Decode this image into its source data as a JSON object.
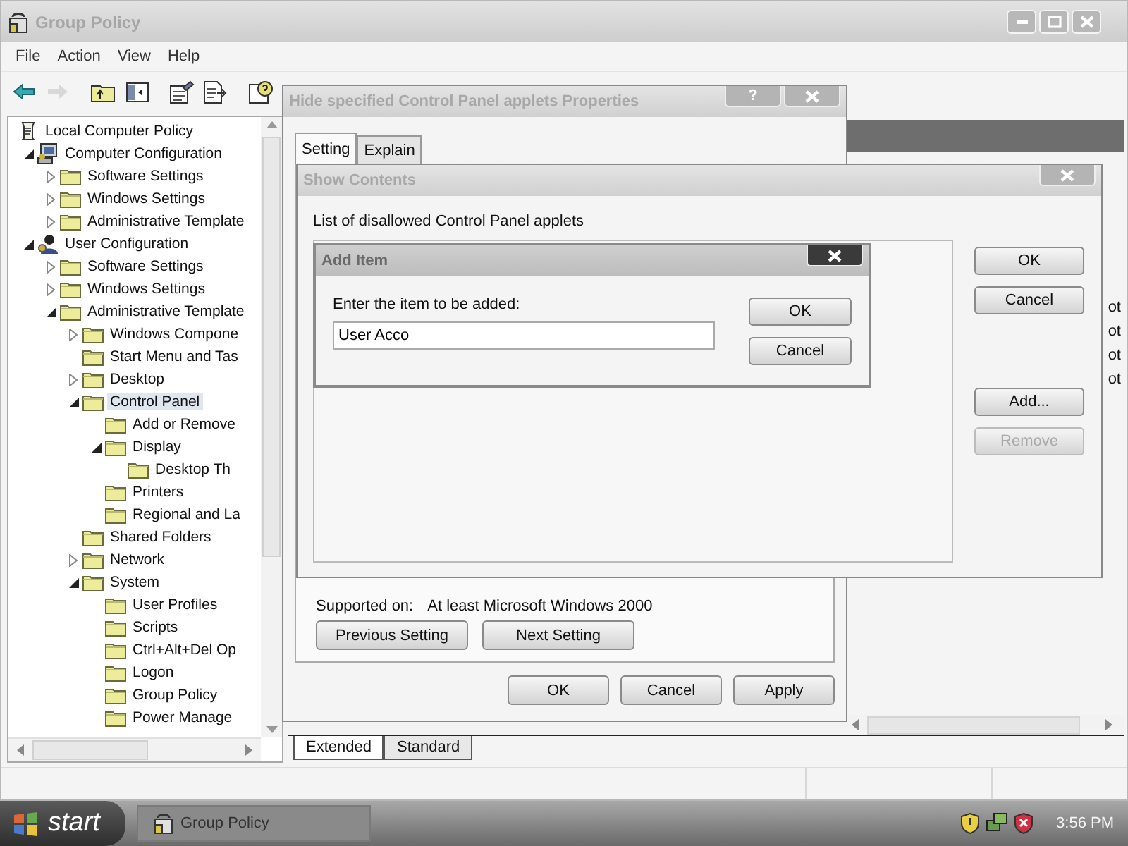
{
  "main_window": {
    "title": "Group Policy",
    "menu": [
      "File",
      "Action",
      "View",
      "Help"
    ],
    "toolbar": [
      {
        "kind": "back",
        "disabled": false
      },
      {
        "kind": "forward",
        "disabled": true
      },
      {
        "kind": "up",
        "disabled": false
      },
      {
        "kind": "tree",
        "disabled": false
      },
      {
        "kind": "properties",
        "disabled": false
      },
      {
        "kind": "export",
        "disabled": false
      },
      {
        "kind": "help",
        "disabled": false
      }
    ],
    "tree": [
      {
        "label": "Local Computer Policy",
        "kind": "policy",
        "selected": false,
        "children": [
          {
            "label": "Computer Configuration",
            "kind": "computer",
            "expanded": true,
            "selected": false,
            "children": [
              {
                "label": "Software Settings",
                "kind": "folder",
                "expanded": false,
                "selected": false
              },
              {
                "label": "Windows Settings",
                "kind": "folder",
                "expanded": false,
                "selected": false
              },
              {
                "label": "Administrative Template",
                "kind": "folder",
                "expanded": false,
                "selected": false
              }
            ]
          },
          {
            "label": "User Configuration",
            "kind": "user",
            "expanded": true,
            "selected": false,
            "children": [
              {
                "label": "Software Settings",
                "kind": "folder",
                "expanded": false,
                "selected": false
              },
              {
                "label": "Windows Settings",
                "kind": "folder",
                "expanded": false,
                "selected": false
              },
              {
                "label": "Administrative Template",
                "kind": "folder",
                "expanded": true,
                "selected": false,
                "children": [
                  {
                    "label": "Windows Compone",
                    "kind": "folder",
                    "expanded": false,
                    "selected": false
                  },
                  {
                    "label": "Start Menu and Tas",
                    "kind": "folder",
                    "selected": false
                  },
                  {
                    "label": "Desktop",
                    "kind": "folder",
                    "expanded": false,
                    "selected": false
                  },
                  {
                    "label": "Control Panel",
                    "kind": "folder",
                    "expanded": true,
                    "selected": true,
                    "children": [
                      {
                        "label": "Add or Remove",
                        "kind": "folder",
                        "selected": false
                      },
                      {
                        "label": "Display",
                        "kind": "folder",
                        "expanded": true,
                        "selected": false,
                        "children": [
                          {
                            "label": "Desktop Th",
                            "kind": "folder",
                            "selected": false
                          }
                        ]
                      },
                      {
                        "label": "Printers",
                        "kind": "folder",
                        "selected": false
                      },
                      {
                        "label": "Regional and La",
                        "kind": "folder",
                        "selected": false
                      }
                    ]
                  },
                  {
                    "label": "Shared Folders",
                    "kind": "folder",
                    "selected": false
                  },
                  {
                    "label": "Network",
                    "kind": "folder",
                    "expanded": false,
                    "selected": false
                  },
                  {
                    "label": "System",
                    "kind": "folder",
                    "expanded": true,
                    "selected": false,
                    "children": [
                      {
                        "label": "User Profiles",
                        "kind": "folder",
                        "selected": false
                      },
                      {
                        "label": "Scripts",
                        "kind": "folder",
                        "selected": false
                      },
                      {
                        "label": "Ctrl+Alt+Del Op",
                        "kind": "folder",
                        "selected": false
                      },
                      {
                        "label": "Logon",
                        "kind": "folder",
                        "selected": false
                      },
                      {
                        "label": "Group Policy",
                        "kind": "folder",
                        "selected": false
                      },
                      {
                        "label": "Power Manage",
                        "kind": "folder",
                        "selected": false
                      }
                    ]
                  }
                ]
              }
            ]
          }
        ]
      }
    ],
    "state_column": [
      "ot",
      "ot",
      "ot",
      "ot"
    ],
    "view_tabs": [
      {
        "label": "Extended",
        "selected": true
      },
      {
        "label": "Standard",
        "selected": false
      }
    ]
  },
  "properties_dialog": {
    "title": "Hide specified Control Panel applets Properties",
    "help_button": "?",
    "tabs": [
      {
        "label": "Setting",
        "selected": true
      },
      {
        "label": "Explain",
        "selected": false
      }
    ],
    "supported_label": "Supported on:",
    "supported_value": "At least Microsoft Windows 2000",
    "nav_buttons": [
      "Previous Setting",
      "Next Setting"
    ],
    "buttons": [
      "OK",
      "Cancel",
      "Apply"
    ]
  },
  "show_contents_dialog": {
    "title": "Show Contents",
    "list_label": "List of disallowed Control Panel applets",
    "buttons": [
      {
        "label": "OK",
        "disabled": false
      },
      {
        "label": "Cancel",
        "disabled": false
      },
      {
        "label": "Add...",
        "disabled": false
      },
      {
        "label": "Remove",
        "disabled": true
      }
    ]
  },
  "add_item_dialog": {
    "title": "Add Item",
    "prompt": "Enter the item to be added:",
    "value": "User Acco",
    "buttons": [
      "OK",
      "Cancel"
    ]
  },
  "taskbar": {
    "start": "start",
    "tasks": [
      {
        "label": "Group Policy",
        "selected": false
      }
    ],
    "clock": "3:56 PM"
  }
}
